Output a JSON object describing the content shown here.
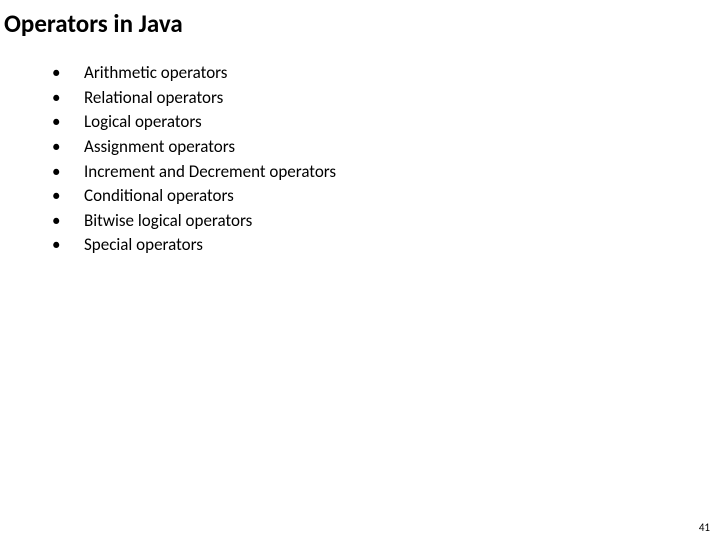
{
  "title": "Operators in Java",
  "bullets": [
    "Arithmetic operators",
    "Relational operators",
    "Logical operators",
    "Assignment operators",
    "Increment and Decrement operators",
    "Conditional operators",
    "Bitwise logical operators",
    "Special operators"
  ],
  "page_number": "41",
  "bullet_char": "•"
}
